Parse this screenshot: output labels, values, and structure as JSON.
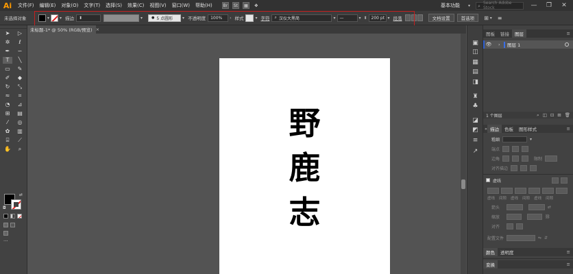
{
  "app": {
    "logo": "Ai"
  },
  "menubar": {
    "items": [
      "文件(F)",
      "编辑(E)",
      "对象(O)",
      "文字(T)",
      "选择(S)",
      "效果(C)",
      "视图(V)",
      "窗口(W)",
      "帮助(H)"
    ],
    "icons": [
      "Br",
      "St"
    ],
    "layout_label": "基本功能",
    "search_placeholder": "Search Adobe Stock",
    "window_buttons": [
      "—",
      "❐",
      "✕"
    ]
  },
  "controlbar": {
    "selection_label": "未选择对象",
    "stroke_label": "描边",
    "point_label": "5 点圆形",
    "opacity_label": "不透明度",
    "opacity_value": "100%",
    "style_label": "样式",
    "char_label": "字符",
    "font_value": "汉仪大黑简",
    "font_style_value": "—",
    "size_value": "200 pt",
    "paragraph_label": "段落",
    "doc_setup_button": "文档设置",
    "preferences_button": "首选项",
    "colors": {
      "fill": "#000000",
      "highlight_border": "#c81e1e"
    }
  },
  "document": {
    "tab_title": "未标题-1* @ 50% (RGB/预览)",
    "tab_close": "×",
    "artboard_text": [
      "野",
      "鹿",
      "志"
    ]
  },
  "layers_panel": {
    "tabs": [
      "图板",
      "链接",
      "图层"
    ],
    "active_tab": "图层",
    "menu_icon": "≡",
    "layer_name": "图层 1",
    "footer_count": "1 个图层"
  },
  "stroke_panel": {
    "tabs": [
      "描边",
      "色板",
      "图形样式"
    ],
    "active_tab": "描边",
    "weight_label": "粗细",
    "row_labels": [
      "端点",
      "边角",
      "对齐描边"
    ],
    "limit_label": "限制",
    "dashed_label": "虚线",
    "dash_labels": [
      "虚线",
      "间隙",
      "虚线",
      "间隙",
      "虚线",
      "间隙"
    ],
    "arrow_label": "箭头",
    "scale_label": "缩放",
    "align_label": "对齐",
    "profile_label": "配置文件"
  },
  "color_panel": {
    "tabs": [
      "颜色",
      "透明度"
    ],
    "active_tab": "颜色"
  },
  "transform_panel": {
    "tabs": [
      "变换"
    ],
    "active_tab": "变换"
  }
}
